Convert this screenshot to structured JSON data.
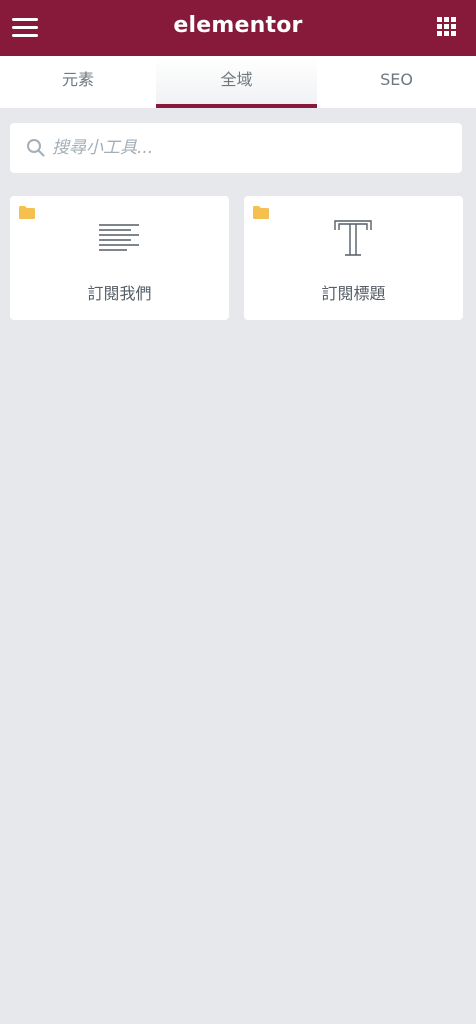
{
  "header": {
    "logo": "elementor",
    "menu_icon": "hamburger-menu-icon",
    "apps_icon": "grid-apps-icon",
    "brand_color": "#871a3a"
  },
  "tabs": [
    {
      "label": "元素",
      "active": false
    },
    {
      "label": "全域",
      "active": true
    },
    {
      "label": "SEO",
      "active": false
    }
  ],
  "search": {
    "placeholder": "搜尋小工具...",
    "value": "",
    "icon": "search-icon"
  },
  "widgets": [
    {
      "label": "訂閱我們",
      "icon": "text-editor-icon",
      "badge_icon": "folder-icon"
    },
    {
      "label": "訂閱標題",
      "icon": "heading-icon",
      "badge_icon": "folder-icon"
    }
  ],
  "colors": {
    "background": "#e6e8ec",
    "folder": "#f4c151",
    "text": "#6d7882"
  }
}
